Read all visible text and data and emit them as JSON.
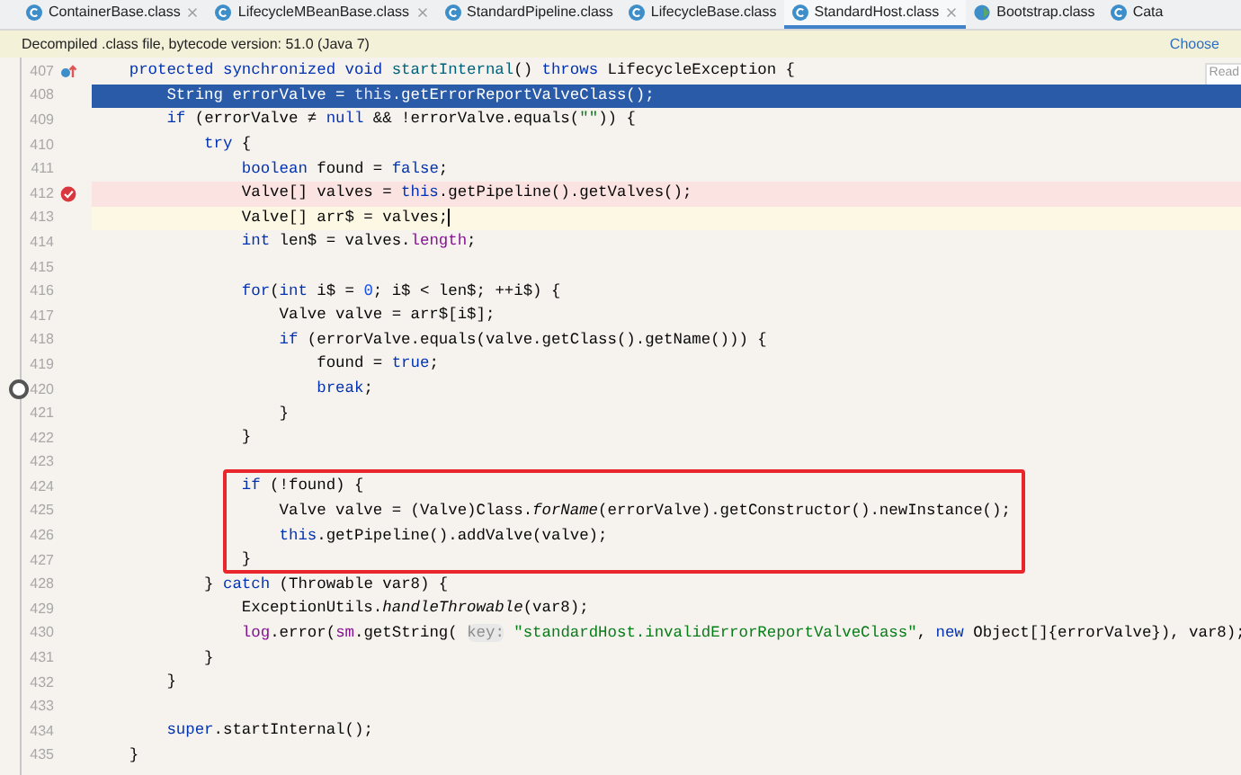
{
  "tabs": [
    {
      "label": "ContainerBase.class",
      "selected": false,
      "closable": true,
      "kind": "class"
    },
    {
      "label": "LifecycleMBeanBase.class",
      "selected": false,
      "closable": true,
      "kind": "class"
    },
    {
      "label": "StandardPipeline.class",
      "selected": false,
      "closable": false,
      "kind": "class"
    },
    {
      "label": "LifecycleBase.class",
      "selected": false,
      "closable": false,
      "kind": "class"
    },
    {
      "label": "StandardHost.class",
      "selected": true,
      "closable": true,
      "kind": "class"
    },
    {
      "label": "Bootstrap.class",
      "selected": false,
      "closable": false,
      "kind": "main"
    },
    {
      "label": "Cata",
      "selected": false,
      "closable": false,
      "kind": "class"
    }
  ],
  "notice": {
    "text": "Decompiled .class file, bytecode version: 51.0 (Java 7)",
    "action": "Choose"
  },
  "reader_mode": "Read",
  "lines": [
    {
      "number": "407",
      "selected": false,
      "breakpoint": false,
      "caret": false,
      "override": true,
      "boxed": false,
      "tokens": [
        {
          "text": "    protected synchronized void ",
          "kind": "keyword"
        },
        {
          "text": "startInternal",
          "kind": "declaration"
        },
        {
          "text": "() ",
          "kind": "plain"
        },
        {
          "text": "throws",
          "kind": "keyword"
        },
        {
          "text": " LifecycleException {",
          "kind": "plain"
        }
      ]
    },
    {
      "number": "408",
      "selected": true,
      "breakpoint": false,
      "caret": false,
      "override": false,
      "boxed": false,
      "tokens": [
        {
          "text": "        String errorValve = ",
          "kind": "plain"
        },
        {
          "text": "this",
          "kind": "keyword"
        },
        {
          "text": ".getErrorReportValveClass();",
          "kind": "plain"
        }
      ]
    },
    {
      "number": "409",
      "selected": false,
      "breakpoint": false,
      "caret": false,
      "override": false,
      "boxed": false,
      "tokens": [
        {
          "text": "        if",
          "kind": "keyword"
        },
        {
          "text": " (errorValve ≠ ",
          "kind": "plain"
        },
        {
          "text": "null",
          "kind": "keyword"
        },
        {
          "text": " && !errorValve.equals(",
          "kind": "plain"
        },
        {
          "text": "\"\"",
          "kind": "string"
        },
        {
          "text": ")) {",
          "kind": "plain"
        }
      ]
    },
    {
      "number": "410",
      "selected": false,
      "breakpoint": false,
      "caret": false,
      "override": false,
      "boxed": false,
      "tokens": [
        {
          "text": "            try",
          "kind": "keyword"
        },
        {
          "text": " {",
          "kind": "plain"
        }
      ]
    },
    {
      "number": "411",
      "selected": false,
      "breakpoint": false,
      "caret": false,
      "override": false,
      "boxed": false,
      "tokens": [
        {
          "text": "                boolean",
          "kind": "keyword"
        },
        {
          "text": " found = ",
          "kind": "plain"
        },
        {
          "text": "false",
          "kind": "keyword"
        },
        {
          "text": ";",
          "kind": "plain"
        }
      ]
    },
    {
      "number": "412",
      "selected": false,
      "breakpoint": true,
      "caret": false,
      "override": false,
      "boxed": false,
      "tokens": [
        {
          "text": "                Valve[] valves = ",
          "kind": "plain"
        },
        {
          "text": "this",
          "kind": "keyword"
        },
        {
          "text": ".getPipeline().getValves();",
          "kind": "plain"
        }
      ]
    },
    {
      "number": "413",
      "selected": false,
      "breakpoint": false,
      "caret": true,
      "override": false,
      "boxed": false,
      "tokens": [
        {
          "text": "                Valve[] arr$ = valves;",
          "kind": "plain"
        }
      ]
    },
    {
      "number": "414",
      "selected": false,
      "breakpoint": false,
      "caret": false,
      "override": false,
      "boxed": false,
      "tokens": [
        {
          "text": "                int",
          "kind": "keyword"
        },
        {
          "text": " len$ = valves.",
          "kind": "plain"
        },
        {
          "text": "length",
          "kind": "field"
        },
        {
          "text": ";",
          "kind": "plain"
        }
      ]
    },
    {
      "number": "415",
      "selected": false,
      "breakpoint": false,
      "caret": false,
      "override": false,
      "boxed": false
    },
    {
      "number": "416",
      "selected": false,
      "breakpoint": false,
      "caret": false,
      "override": false,
      "boxed": false,
      "tokens": [
        {
          "text": "                for",
          "kind": "keyword"
        },
        {
          "text": "(",
          "kind": "plain"
        },
        {
          "text": "int",
          "kind": "keyword"
        },
        {
          "text": " i$ = ",
          "kind": "plain"
        },
        {
          "text": "0",
          "kind": "number"
        },
        {
          "text": "; i$ < len$; ++i$) {",
          "kind": "plain"
        }
      ]
    },
    {
      "number": "417",
      "selected": false,
      "breakpoint": false,
      "caret": false,
      "override": false,
      "boxed": false,
      "tokens": [
        {
          "text": "                    Valve valve = arr$[i$];",
          "kind": "plain"
        }
      ]
    },
    {
      "number": "418",
      "selected": false,
      "breakpoint": false,
      "caret": false,
      "override": false,
      "boxed": false,
      "tokens": [
        {
          "text": "                    if",
          "kind": "keyword"
        },
        {
          "text": " (errorValve.equals(valve.getClass().getName())) {",
          "kind": "plain"
        }
      ]
    },
    {
      "number": "419",
      "selected": false,
      "breakpoint": false,
      "caret": false,
      "override": false,
      "boxed": false,
      "tokens": [
        {
          "text": "                        found = ",
          "kind": "plain"
        },
        {
          "text": "true",
          "kind": "keyword"
        },
        {
          "text": ";",
          "kind": "plain"
        }
      ]
    },
    {
      "number": "420",
      "selected": false,
      "breakpoint": false,
      "caret": false,
      "override": false,
      "boxed": false,
      "tokens": [
        {
          "text": "                        break",
          "kind": "keyword"
        },
        {
          "text": ";",
          "kind": "plain"
        }
      ]
    },
    {
      "number": "421",
      "selected": false,
      "breakpoint": false,
      "caret": false,
      "override": false,
      "boxed": false,
      "tokens": [
        {
          "text": "                    }",
          "kind": "plain"
        }
      ]
    },
    {
      "number": "422",
      "selected": false,
      "breakpoint": false,
      "caret": false,
      "override": false,
      "boxed": false,
      "tokens": [
        {
          "text": "                }",
          "kind": "plain"
        }
      ]
    },
    {
      "number": "423",
      "selected": false,
      "breakpoint": false,
      "caret": false,
      "override": false,
      "boxed": false
    },
    {
      "number": "424",
      "selected": false,
      "breakpoint": false,
      "caret": false,
      "override": false,
      "boxed": true,
      "tokens": [
        {
          "text": "                if",
          "kind": "keyword"
        },
        {
          "text": " (!found) {",
          "kind": "plain"
        }
      ]
    },
    {
      "number": "425",
      "selected": false,
      "breakpoint": false,
      "caret": false,
      "override": false,
      "boxed": true,
      "tokens": [
        {
          "text": "                    Valve valve = (Valve)Class.",
          "kind": "plain"
        },
        {
          "text": "forName",
          "kind": "static"
        },
        {
          "text": "(errorValve).getConstructor().newInstance();",
          "kind": "plain"
        }
      ]
    },
    {
      "number": "426",
      "selected": false,
      "breakpoint": false,
      "caret": false,
      "override": false,
      "boxed": true,
      "tokens": [
        {
          "text": "                    this",
          "kind": "keyword"
        },
        {
          "text": ".getPipeline().addValve(valve);",
          "kind": "plain"
        }
      ]
    },
    {
      "number": "427",
      "selected": false,
      "breakpoint": false,
      "caret": false,
      "override": false,
      "boxed": true,
      "tokens": [
        {
          "text": "                }",
          "kind": "plain"
        }
      ]
    },
    {
      "number": "428",
      "selected": false,
      "breakpoint": false,
      "caret": false,
      "override": false,
      "boxed": false,
      "tokens": [
        {
          "text": "            } ",
          "kind": "plain"
        },
        {
          "text": "catch",
          "kind": "keyword"
        },
        {
          "text": " (Throwable var8) {",
          "kind": "plain"
        }
      ]
    },
    {
      "number": "429",
      "selected": false,
      "breakpoint": false,
      "caret": false,
      "override": false,
      "boxed": false,
      "tokens": [
        {
          "text": "                ExceptionUtils.",
          "kind": "plain"
        },
        {
          "text": "handleThrowable",
          "kind": "static"
        },
        {
          "text": "(var8);",
          "kind": "plain"
        }
      ]
    },
    {
      "number": "430",
      "selected": false,
      "breakpoint": false,
      "caret": false,
      "override": false,
      "boxed": false,
      "tokens": [
        {
          "text": "                log",
          "kind": "field"
        },
        {
          "text": ".error(",
          "kind": "plain"
        },
        {
          "text": "sm",
          "kind": "field"
        },
        {
          "text": ".getString( ",
          "kind": "plain"
        },
        {
          "text": "key:",
          "kind": "hint"
        },
        {
          "text": " \"standardHost.invalidErrorReportValveClass\"",
          "kind": "string"
        },
        {
          "text": ", ",
          "kind": "plain"
        },
        {
          "text": "new",
          "kind": "keyword"
        },
        {
          "text": " Object[]{errorValve}), var8);",
          "kind": "plain"
        }
      ]
    },
    {
      "number": "431",
      "selected": false,
      "breakpoint": false,
      "caret": false,
      "override": false,
      "boxed": false,
      "tokens": [
        {
          "text": "            }",
          "kind": "plain"
        }
      ]
    },
    {
      "number": "432",
      "selected": false,
      "breakpoint": false,
      "caret": false,
      "override": false,
      "boxed": false,
      "tokens": [
        {
          "text": "        }",
          "kind": "plain"
        }
      ]
    },
    {
      "number": "433",
      "selected": false,
      "breakpoint": false,
      "caret": false,
      "override": false,
      "boxed": false
    },
    {
      "number": "434",
      "selected": false,
      "breakpoint": false,
      "caret": false,
      "override": false,
      "boxed": false,
      "tokens": [
        {
          "text": "        super",
          "kind": "keyword"
        },
        {
          "text": ".startInternal();",
          "kind": "plain"
        }
      ]
    },
    {
      "number": "435",
      "selected": false,
      "breakpoint": false,
      "caret": false,
      "override": false,
      "boxed": false,
      "tokens": [
        {
          "text": "    }",
          "kind": "plain"
        }
      ]
    }
  ]
}
